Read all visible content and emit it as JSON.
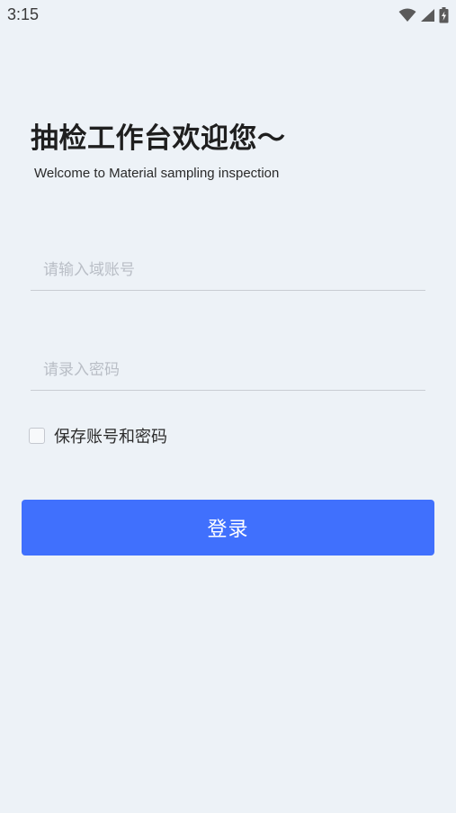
{
  "status_bar": {
    "time": "3:15",
    "icons": [
      "wifi-icon",
      "cell-signal-icon",
      "battery-charging-icon"
    ]
  },
  "header": {
    "title": "抽检工作台欢迎您～",
    "subtitle": "Welcome to Material sampling inspection"
  },
  "form": {
    "account_placeholder": "请输入域账号",
    "account_value": "",
    "password_placeholder": "请录入密码",
    "password_value": "",
    "remember_label": "保存账号和密码",
    "remember_checked": false,
    "login_label": "登录"
  },
  "colors": {
    "background": "#edf2f7",
    "primary": "#4070fd",
    "underline": "#c9cdd3",
    "placeholder": "#b9bec6"
  }
}
